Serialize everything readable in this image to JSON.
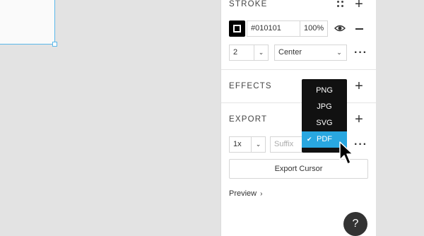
{
  "stroke": {
    "title": "STROKE",
    "color_hex": "#010101",
    "opacity": "100%",
    "width": "2",
    "position": "Center"
  },
  "effects": {
    "title": "EFFECTS"
  },
  "export": {
    "title": "EXPORT",
    "scale": "1x",
    "suffix_placeholder": "Suffix",
    "button_label": "Export Cursor",
    "preview_label": "Preview"
  },
  "format_menu": {
    "items": [
      "PNG",
      "JPG",
      "SVG",
      "PDF"
    ],
    "selected": "PDF"
  },
  "help": {
    "label": "?"
  },
  "colors": {
    "accent": "#29a7e0",
    "selection_outline": "#5bb8ea",
    "menu_bg": "#111111"
  }
}
